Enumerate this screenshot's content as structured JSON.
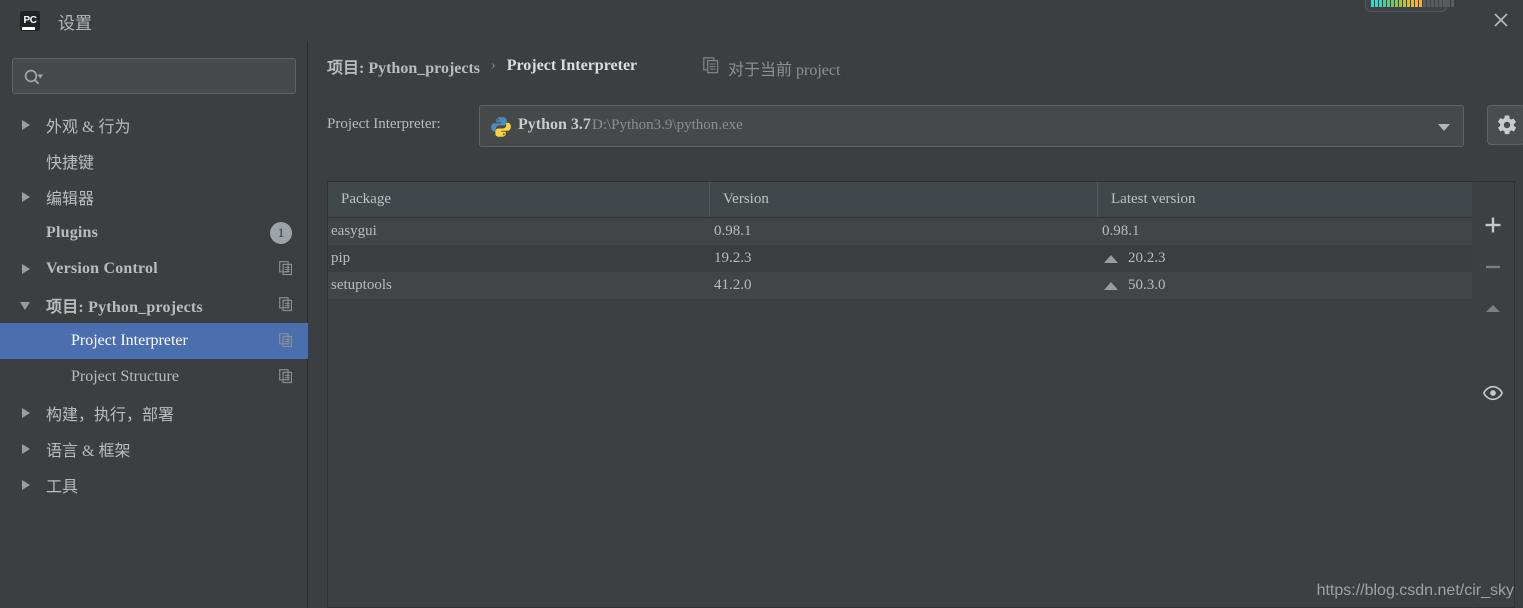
{
  "window": {
    "title": "设置",
    "logo_text": "PC",
    "logo_icon": "pycharm-logo",
    "close_icon": "close-icon",
    "eq_icon": "level-meter-widget"
  },
  "sidebar": {
    "search": {
      "value": "",
      "placeholder": "",
      "icon": "search-icon"
    },
    "items": [
      {
        "label": "外观 & 行为",
        "arrow": "right",
        "level": 0,
        "bold": false,
        "copy": false,
        "badge": null,
        "selected": false
      },
      {
        "label": "快捷键",
        "arrow": "none",
        "level": 0,
        "bold": false,
        "copy": false,
        "badge": null,
        "selected": false
      },
      {
        "label": "编辑器",
        "arrow": "right",
        "level": 0,
        "bold": false,
        "copy": false,
        "badge": null,
        "selected": false
      },
      {
        "label": "Plugins",
        "arrow": "none",
        "level": 0,
        "bold": true,
        "copy": false,
        "badge": "1",
        "selected": false
      },
      {
        "label": "Version Control",
        "arrow": "right",
        "level": 0,
        "bold": true,
        "copy": true,
        "badge": null,
        "selected": false
      },
      {
        "label": "项目: Python_projects",
        "arrow": "down",
        "level": 0,
        "bold": true,
        "copy": true,
        "badge": null,
        "selected": false
      },
      {
        "label": "Project Interpreter",
        "arrow": "none",
        "level": 1,
        "bold": false,
        "copy": true,
        "badge": null,
        "selected": true
      },
      {
        "label": "Project Structure",
        "arrow": "none",
        "level": 1,
        "bold": false,
        "copy": true,
        "badge": null,
        "selected": false
      },
      {
        "label": "构建，执行，部署",
        "arrow": "right",
        "level": 0,
        "bold": false,
        "copy": false,
        "badge": null,
        "selected": false
      },
      {
        "label": "语言 & 框架",
        "arrow": "right",
        "level": 0,
        "bold": false,
        "copy": false,
        "badge": null,
        "selected": false
      },
      {
        "label": "工具",
        "arrow": "right",
        "level": 0,
        "bold": false,
        "copy": false,
        "badge": null,
        "selected": false
      }
    ]
  },
  "main": {
    "breadcrumb": {
      "project": "项目: Python_projects",
      "separator": "›",
      "current": "Project Interpreter"
    },
    "for_project": {
      "label": "对于当前 project",
      "icon": "copy-icon"
    },
    "interpreter": {
      "label": "Project Interpreter:",
      "icon": "python-icon",
      "name": "Python 3.7",
      "path": "D:\\Python3.9\\python.exe",
      "dropdown_icon": "chevron-down-icon",
      "settings_icon": "gear-icon"
    },
    "table": {
      "columns": [
        "Package",
        "Version",
        "Latest version"
      ],
      "rows": [
        {
          "package": "easygui",
          "version": "0.98.1",
          "latest": "0.98.1",
          "upgradable": false
        },
        {
          "package": "pip",
          "version": "19.2.3",
          "latest": "20.2.3",
          "upgradable": true
        },
        {
          "package": "setuptools",
          "version": "41.2.0",
          "latest": "50.3.0",
          "upgradable": true
        }
      ]
    },
    "toolbar": [
      {
        "name": "add-package-button",
        "icon": "plus-icon"
      },
      {
        "name": "remove-package-button",
        "icon": "minus-icon"
      },
      {
        "name": "upgrade-package-button",
        "icon": "up-arrow-icon"
      },
      {
        "name": "show-early-releases-button",
        "icon": "eye-icon"
      }
    ]
  },
  "watermark": "https://blog.csdn.net/cir_sky"
}
